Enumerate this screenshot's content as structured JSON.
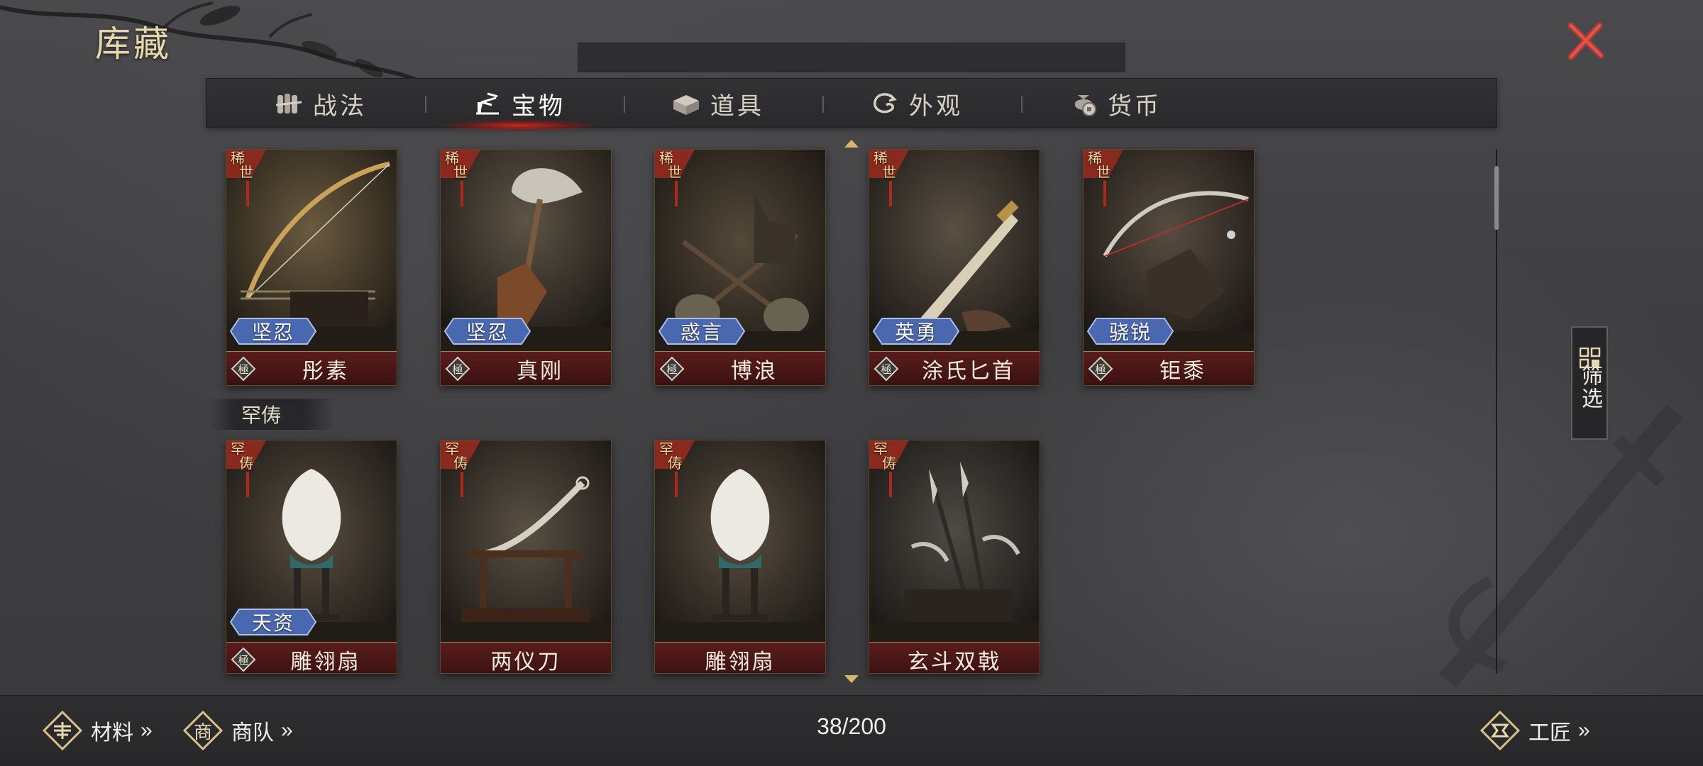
{
  "header": {
    "title": "库藏"
  },
  "tabs": [
    {
      "label": "战法",
      "icon": "scroll-bundle-icon",
      "active": false
    },
    {
      "label": "宝物",
      "icon": "treasure-stand-icon",
      "active": true
    },
    {
      "label": "道具",
      "icon": "box-icon",
      "active": false
    },
    {
      "label": "外观",
      "icon": "swirl-icon",
      "active": false
    },
    {
      "label": "货币",
      "icon": "coin-pouch-icon",
      "active": false
    }
  ],
  "rare_row": [
    {
      "rarity": "稀世",
      "rank": "極",
      "name": "彤素",
      "trait": "坚忍",
      "icon": "bow-icon"
    },
    {
      "rarity": "稀世",
      "rank": "極",
      "name": "真刚",
      "trait": "坚忍",
      "icon": "axe-icon"
    },
    {
      "rarity": "稀世",
      "rank": "極",
      "name": "博浪",
      "trait": "惑言",
      "icon": "hammer-icon"
    },
    {
      "rarity": "稀世",
      "rank": "極",
      "name": "涂氏匕首",
      "trait": "英勇",
      "icon": "dagger-icon"
    },
    {
      "rarity": "稀世",
      "rank": "極",
      "name": "钜黍",
      "trait": "骁锐",
      "icon": "crossbow-icon"
    }
  ],
  "section_label": "罕俦",
  "uncommon_row": [
    {
      "rarity": "罕俦",
      "rank": "極",
      "name": "雕翎扇",
      "trait": "天资",
      "icon": "feather-fan-icon"
    },
    {
      "rarity": "罕俦",
      "rank": "",
      "name": "两仪刀",
      "trait": "",
      "icon": "sabre-icon"
    },
    {
      "rarity": "罕俦",
      "rank": "",
      "name": "雕翎扇",
      "trait": "",
      "icon": "feather-fan-icon"
    },
    {
      "rarity": "罕俦",
      "rank": "",
      "name": "玄斗双戟",
      "trait": "",
      "icon": "twin-halberd-icon"
    }
  ],
  "filter": {
    "label": "筛选"
  },
  "footer": {
    "materials": "材料",
    "caravan": "商队",
    "caravan_icon_char": "商",
    "artisan": "工匠",
    "chevron": "»",
    "count": "38/200"
  },
  "colors": {
    "accent_red": "#c8302a",
    "gold": "#e8d6ad",
    "card_bar": "#5a1c1c",
    "tag_blue": "#4a68b0"
  }
}
